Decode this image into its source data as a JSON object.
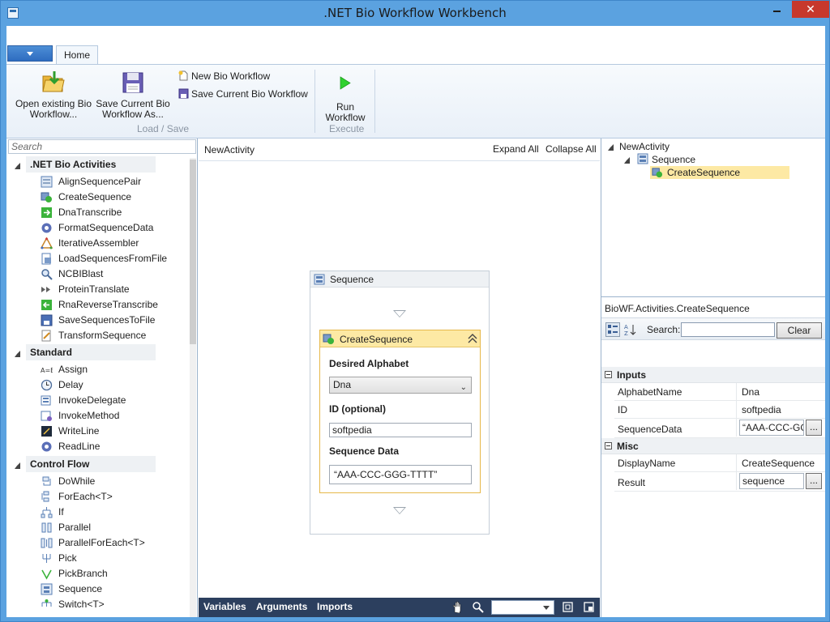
{
  "window": {
    "title": ".NET Bio Workflow Workbench",
    "close_glyph": "✕"
  },
  "ribbon": {
    "tab_home": "Home",
    "open_existing": "Open existing Bio Workflow...",
    "open_existing_l1": "Open existing Bio",
    "open_existing_l2": "Workflow...",
    "save_as_l1": "Save Current Bio",
    "save_as_l2": "Workflow As...",
    "new_bio_workflow": "New Bio Workflow",
    "save_current": "Save Current Bio Workflow",
    "group_load_save": "Load / Save",
    "run_l1": "Run",
    "run_l2": "Workflow",
    "group_execute": "Execute"
  },
  "toolbox": {
    "search_placeholder": "Search",
    "categories": [
      {
        "label": ".NET Bio Activities",
        "items": [
          "AlignSequencePair",
          "CreateSequence",
          "DnaTranscribe",
          "FormatSequenceData",
          "IterativeAssembler",
          "LoadSequencesFromFile",
          "NCBIBlast",
          "ProteinTranslate",
          "RnaReverseTranscribe",
          "SaveSequencesToFile",
          "TransformSequence"
        ]
      },
      {
        "label": "Standard",
        "items": [
          "Assign",
          "Delay",
          "InvokeDelegate",
          "InvokeMethod",
          "WriteLine",
          "ReadLine"
        ]
      },
      {
        "label": "Control Flow",
        "items": [
          "DoWhile",
          "ForEach<T>",
          "If",
          "Parallel",
          "ParallelForEach<T>",
          "Pick",
          "PickBranch",
          "Sequence",
          "Switch<T>"
        ]
      }
    ]
  },
  "designer": {
    "breadcrumb": "NewActivity",
    "expand_all": "Expand All",
    "collapse_all": "Collapse All",
    "sequence_title": "Sequence",
    "activity": {
      "title": "CreateSequence",
      "alphabet_label": "Desired Alphabet",
      "alphabet_value": "Dna",
      "id_label": "ID (optional)",
      "id_value": "softpedia",
      "seqdata_label": "Sequence Data",
      "seqdata_value": "“AAA-CCC-GGG-TTTT”"
    },
    "footer": {
      "variables": "Variables",
      "arguments": "Arguments",
      "imports": "Imports"
    }
  },
  "tree": {
    "root": "NewActivity",
    "child": "Sequence",
    "leaf": "CreateSequence"
  },
  "properties": {
    "title": "BioWF.Activities.CreateSequence",
    "search_label": "Search:",
    "clear": "Clear",
    "group_inputs": "Inputs",
    "group_misc": "Misc",
    "rows": [
      {
        "name": "AlphabetName",
        "value": "Dna"
      },
      {
        "name": "ID",
        "value": "softpedia"
      },
      {
        "name": "SequenceData",
        "value": "“AAA-CCC-GGG-TTTT”"
      },
      {
        "name": "DisplayName",
        "value": "CreateSequence"
      },
      {
        "name": "Result",
        "value": "sequence"
      }
    ],
    "dots": "..."
  },
  "colors": {
    "titlebar": "#5ba2e0",
    "close": "#c7382c",
    "activity_header": "#fde9a4",
    "footer": "#2c3f5e"
  }
}
